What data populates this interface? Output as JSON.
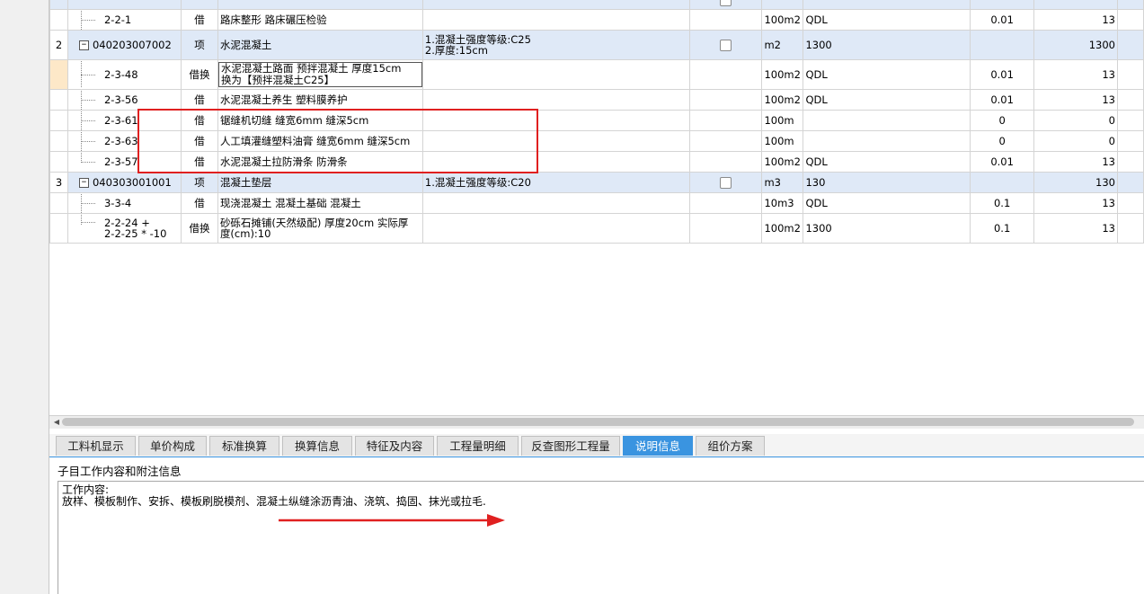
{
  "grid": {
    "top_row": {
      "code": "2-2-1",
      "type": "借",
      "name": "路床整形 路床碾压检验",
      "unit": "100m2",
      "qty_expr": "QDL",
      "coef": "0.01",
      "qty": "13"
    },
    "rows": [
      {
        "kind": "main",
        "seq": "2",
        "code": "040203007002",
        "type": "项",
        "name": "水泥混凝土",
        "feature_1": "1.混凝土强度等级:C25",
        "feature_2": "2.厚度:15cm",
        "unit": "m2",
        "qty_expr": "1300",
        "coef": "",
        "qty": "1300"
      },
      {
        "kind": "sub",
        "code": "2-3-48",
        "type": "借换",
        "name_1": "水泥混凝土路面 预拌混凝土 厚度15cm",
        "name_2": "换为【预拌混凝土C25】",
        "unit": "100m2",
        "qty_expr": "QDL",
        "coef": "0.01",
        "qty": "13"
      },
      {
        "kind": "sub",
        "code": "2-3-56",
        "type": "借",
        "name": "水泥混凝土养生 塑料膜养护",
        "unit": "100m2",
        "qty_expr": "QDL",
        "coef": "0.01",
        "qty": "13"
      },
      {
        "kind": "sub",
        "code": "2-3-61",
        "type": "借",
        "name": "锯缝机切缝 缝宽6mm 缝深5cm",
        "unit": "100m",
        "qty_expr": "",
        "coef": "0",
        "qty": "0"
      },
      {
        "kind": "sub",
        "code": "2-3-63",
        "type": "借",
        "name": "人工填灌缝塑料油膏 缝宽6mm 缝深5cm",
        "unit": "100m",
        "qty_expr": "",
        "coef": "0",
        "qty": "0"
      },
      {
        "kind": "sub",
        "code": "2-3-57",
        "type": "借",
        "name": "水泥混凝土拉防滑条 防滑条",
        "unit": "100m2",
        "qty_expr": "QDL",
        "coef": "0.01",
        "qty": "13"
      },
      {
        "kind": "main",
        "seq": "3",
        "code": "040303001001",
        "type": "项",
        "name": "混凝土垫层",
        "feature_1": "1.混凝土强度等级:C20",
        "unit": "m3",
        "qty_expr": "130",
        "coef": "",
        "qty": "130"
      },
      {
        "kind": "sub",
        "code": "3-3-4",
        "type": "借",
        "name": "现浇混凝土 混凝土基础 混凝土",
        "unit": "10m3",
        "qty_expr": "QDL",
        "coef": "0.1",
        "qty": "13"
      },
      {
        "kind": "sub",
        "code_1": "2-2-24 +",
        "code_2": "2-2-25 * -10",
        "type": "借换",
        "name_1": "砂砾石摊铺(天然级配) 厚度20cm  实际厚",
        "name_2": "度(cm):10",
        "unit": "100m2",
        "qty_expr": "1300",
        "coef": "0.1",
        "qty": "13"
      }
    ]
  },
  "tabs": [
    {
      "label": "工料机显示",
      "active": false
    },
    {
      "label": "单价构成",
      "active": false
    },
    {
      "label": "标准换算",
      "active": false
    },
    {
      "label": "换算信息",
      "active": false
    },
    {
      "label": "特征及内容",
      "active": false
    },
    {
      "label": "工程量明细",
      "active": false
    },
    {
      "label": "反查图形工程量",
      "active": false
    },
    {
      "label": "说明信息",
      "active": true
    },
    {
      "label": "组价方案",
      "active": false
    }
  ],
  "panel": {
    "title": "子目工作内容和附注信息",
    "content_line_1": "工作内容:",
    "content_line_2": "放样、模板制作、安拆、模板刷脱模剂、混凝土纵缝涂沥青油、浇筑、捣固、抹光或拉毛."
  },
  "annotation_color": "#e02020",
  "active_tab_color": "#3a94e0",
  "main_row_color": "#dfe9f7"
}
